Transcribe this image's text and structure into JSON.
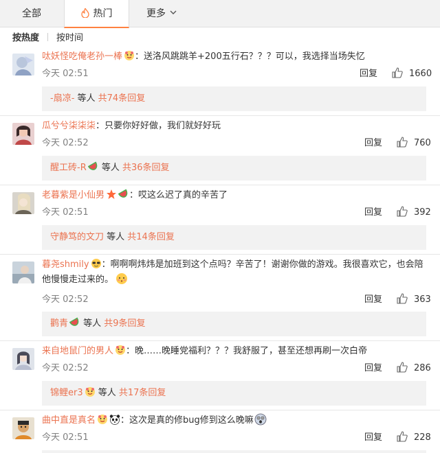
{
  "tabs": {
    "all_label": "全部",
    "hot_label": "热门",
    "more_label": "更多"
  },
  "sort": {
    "by_heat": "按热度",
    "by_time": "按时间"
  },
  "colors": {
    "accent": "#ff8140",
    "username": "#eb7350"
  },
  "comments": [
    {
      "user": "呔妖怪吃俺老孙一棒",
      "text": "：送洛风跳跳羊+200五行石？？？可以，我选择当场失忆",
      "time": "今天 02:51",
      "reply_label": "回复",
      "likes": "1660",
      "sub_user": "-扇凉-",
      "sub_mid": " 等人 ",
      "sub_count": "共74条回复"
    },
    {
      "user": "瓜兮兮柒柒柒",
      "text": "：只要你好好做，我们就好好玩",
      "time": "今天 02:52",
      "reply_label": "回复",
      "likes": "760",
      "sub_user": "醒工砖-R",
      "sub_mid": " 等人 ",
      "sub_count": "共36条回复"
    },
    {
      "user": "老暮紫是小仙男",
      "text": "：哎这么迟了真的辛苦了",
      "time": "今天 02:51",
      "reply_label": "回复",
      "likes": "392",
      "sub_user": "守静笃的文刀",
      "sub_mid": " 等人 ",
      "sub_count": "共14条回复"
    },
    {
      "user": "暮尧shmily",
      "text": "：啊啊啊炜炜是加班到这个点吗？辛苦了！谢谢你做的游戏。我很喜欢它，也会陪",
      "text2": "他慢慢走过来的。",
      "time": "今天 02:52",
      "reply_label": "回复",
      "likes": "363",
      "sub_user": "鹳青",
      "sub_mid": " 等人 ",
      "sub_count": "共9条回复"
    },
    {
      "user": "来自地鼠门的男人",
      "text": "：晚……晚睡党福利？？？我舒服了，甚至还想再刷一次白帝",
      "time": "今天 02:52",
      "reply_label": "回复",
      "likes": "286",
      "sub_user": "锦鲤er3",
      "sub_mid": " 等人 ",
      "sub_count": "共17条回复"
    },
    {
      "user": "曲中直是真名",
      "text": "：这次是真的修bug修到这么晚嘛",
      "time": "今天 02:51",
      "reply_label": "回复",
      "likes": "228"
    }
  ]
}
